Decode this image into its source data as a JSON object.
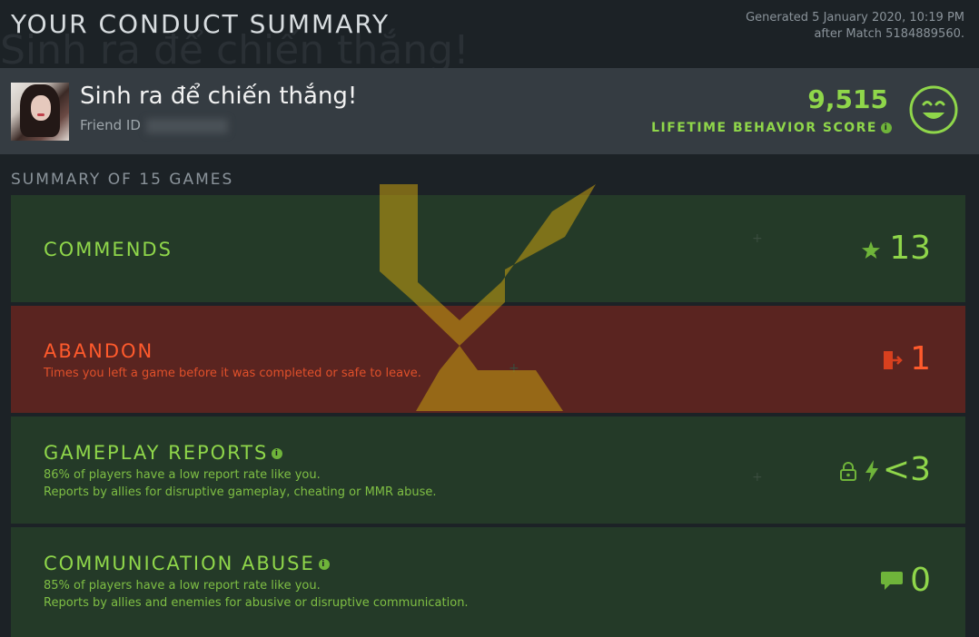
{
  "page": {
    "title": "YOUR CONDUCT SUMMARY",
    "background_text": "Sinh ra để chiến thắng!",
    "generated_line1": "Generated 5 January 2020, 10:19 PM",
    "generated_line2": "after Match 5184889560."
  },
  "profile": {
    "name": "Sinh ra để chiến thắng!",
    "friend_id_label": "Friend ID",
    "score": "9,515",
    "score_label": "LIFETIME BEHAVIOR SCORE",
    "info_glyph": "i"
  },
  "summary": {
    "label": "SUMMARY OF 15 GAMES",
    "commends": {
      "title": "COMMENDS",
      "value": "13",
      "icon": "star-icon"
    },
    "abandon": {
      "title": "ABANDON",
      "description": "Times you left a game before it was completed or safe to leave.",
      "value": "1",
      "icon": "exit-door-icon"
    },
    "gameplay_reports": {
      "title": "GAMEPLAY REPORTS",
      "line1": "86% of players have a low report rate like you.",
      "line2": "Reports by allies for disruptive gameplay, cheating or MMR abuse.",
      "value": "<3",
      "icons": [
        "lock-icon",
        "lightning-icon"
      ]
    },
    "communication_abuse": {
      "title": "COMMUNICATION ABUSE",
      "line1": "85% of players have a low report rate like you.",
      "line2": "Reports by allies and enemies for abusive or disruptive communication.",
      "value": "0",
      "icon": "chat-bubble-icon"
    }
  },
  "colors": {
    "positive": "#8fd64a",
    "negative": "#ff5a2c",
    "background": "#1c2226",
    "header_bar": "#353c42",
    "emblem": "#c8a010"
  }
}
